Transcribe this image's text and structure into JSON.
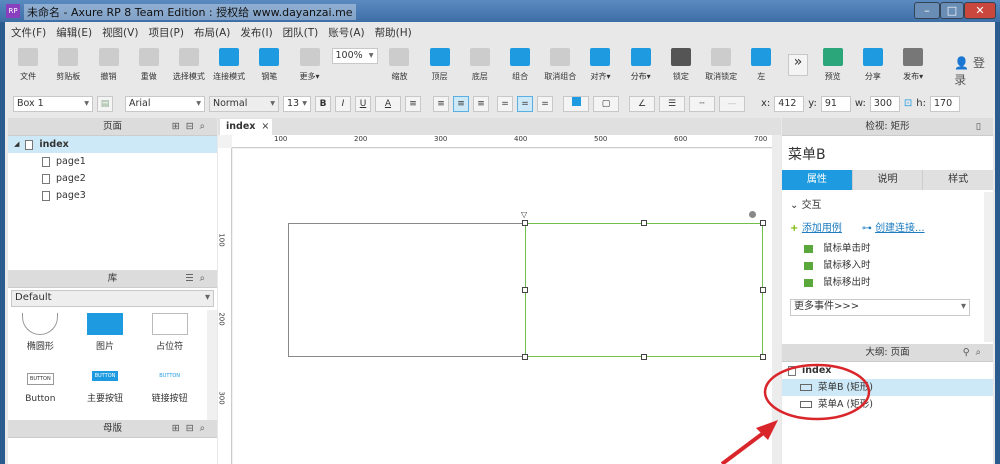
{
  "window": {
    "title": "未命名 - Axure RP 8 Team Edition : 授权给 www.dayanzai.me",
    "logo": "RP",
    "minimize": "–",
    "maximize": "□",
    "close": "✕"
  },
  "menu": [
    "文件(F)",
    "编辑(E)",
    "视图(V)",
    "项目(P)",
    "布局(A)",
    "发布(I)",
    "团队(T)",
    "账号(A)",
    "帮助(H)"
  ],
  "toolbar": {
    "items": [
      {
        "label": "文件",
        "icon": "file-icon"
      },
      {
        "label": "剪贴板",
        "icon": "clipboard-icon"
      },
      {
        "label": "撤销",
        "icon": "undo-icon"
      },
      {
        "label": "重做",
        "icon": "redo-icon"
      },
      {
        "label": "选择模式",
        "icon": "select-mode-icon"
      },
      {
        "label": "连接模式",
        "icon": "connect-mode-icon"
      },
      {
        "label": "钢笔",
        "icon": "pen-icon"
      },
      {
        "label": "更多▾",
        "icon": "more-icon"
      },
      {
        "label": "缩放",
        "icon": "zoom-icon"
      },
      {
        "label": "顶层",
        "icon": "bring-front-icon"
      },
      {
        "label": "底层",
        "icon": "send-back-icon"
      },
      {
        "label": "组合",
        "icon": "group-icon"
      },
      {
        "label": "取消组合",
        "icon": "ungroup-icon"
      },
      {
        "label": "对齐▾",
        "icon": "align-icon"
      },
      {
        "label": "分布▾",
        "icon": "distribute-icon"
      },
      {
        "label": "锁定",
        "icon": "lock-icon"
      },
      {
        "label": "取消锁定",
        "icon": "unlock-icon"
      },
      {
        "label": "左",
        "icon": "left-panel-icon"
      },
      {
        "label": "预览",
        "icon": "preview-icon"
      },
      {
        "label": "分享",
        "icon": "share-icon"
      },
      {
        "label": "发布▾",
        "icon": "publish-icon"
      }
    ],
    "zoom": "100%",
    "login": "登录",
    "overflow": "»"
  },
  "format": {
    "widget": "Box 1",
    "font": "Arial",
    "style": "Normal",
    "size": "13",
    "bold": "B",
    "italic": "I",
    "underline": "U",
    "fontcolor": "A",
    "x_label": "x:",
    "x": "412",
    "y_label": "y:",
    "y": "91",
    "w_label": "w:",
    "w": "300",
    "h_label": "h:",
    "h": "170"
  },
  "pages": {
    "title": "页面",
    "root": "index",
    "children": [
      "page1",
      "page2",
      "page3"
    ]
  },
  "library": {
    "title": "库",
    "selected": "Default",
    "items": [
      "椭圆形",
      "图片",
      "占位符",
      "Button",
      "主要按钮",
      "链接按钮"
    ],
    "button_text": "BUTTON"
  },
  "masters": {
    "title": "母版"
  },
  "canvas": {
    "tab": "index",
    "ruler_top": [
      "100",
      "200",
      "300",
      "400",
      "500",
      "600",
      "700"
    ],
    "ruler_left": [
      "100",
      "200",
      "300"
    ]
  },
  "inspector": {
    "title": "检视: 矩形",
    "name": "菜单B",
    "tabs": [
      "属性",
      "说明",
      "样式"
    ],
    "section": "交互",
    "add_case": "添加用例",
    "create_link": "创建连接...",
    "events": [
      "鼠标单击时",
      "鼠标移入时",
      "鼠标移出时"
    ],
    "more_events": "更多事件>>>"
  },
  "outline": {
    "title": "大纲: 页面",
    "root": "index",
    "items": [
      "菜单B (矩形)",
      "菜单A (矩形)"
    ]
  },
  "colors": {
    "accent": "#1e9be0",
    "selection": "#cde8f7",
    "green_selection": "#6fbf4a",
    "annotation": "#d9262b"
  }
}
